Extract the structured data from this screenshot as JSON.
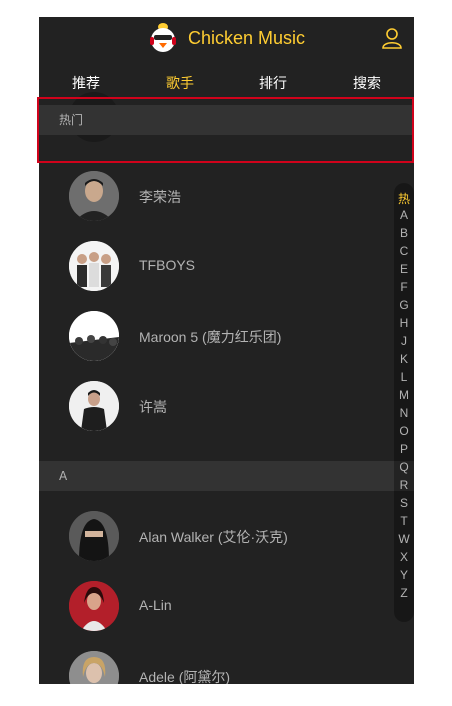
{
  "header": {
    "title": "Chicken Music"
  },
  "tabs": [
    {
      "label": "推荐"
    },
    {
      "label": "歌手"
    },
    {
      "label": "排行"
    },
    {
      "label": "搜索"
    }
  ],
  "active_tab": "歌手",
  "groups": [
    {
      "title": "热门"
    },
    {
      "title": "A"
    }
  ],
  "singers": [
    {
      "name": "李荣浩"
    },
    {
      "name": "TFBOYS"
    },
    {
      "name": "Maroon 5 (魔力红乐团)"
    },
    {
      "name": "许嵩"
    },
    {
      "name": "Alan Walker (艾伦·沃克)"
    },
    {
      "name": "A-Lin"
    },
    {
      "name": "Adele (阿黛尔)"
    }
  ],
  "shortcut": [
    "热",
    "A",
    "B",
    "C",
    "E",
    "F",
    "G",
    "H",
    "J",
    "K",
    "L",
    "M",
    "N",
    "O",
    "P",
    "Q",
    "R",
    "S",
    "T",
    "W",
    "X",
    "Y",
    "Z"
  ],
  "shortcut_active": "热",
  "colors": {
    "accent": "#ffcd32",
    "background": "#222222",
    "group_bg": "#333333",
    "text": "#b3b3b3",
    "highlight": "#d0021b"
  }
}
